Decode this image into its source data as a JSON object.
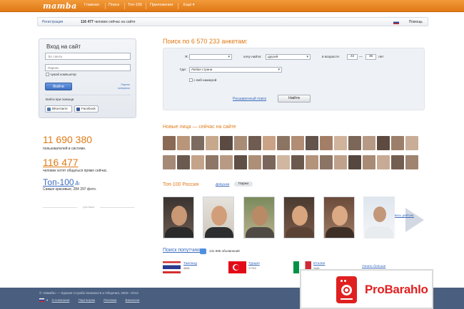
{
  "brand": {
    "logo": "mamba"
  },
  "topnav": [
    "Главная",
    "Поиск",
    "Топ-100",
    "Приложения",
    "Ещё ▾"
  ],
  "subbar": {
    "register": "Регистрация",
    "online_count": "116 477",
    "online_text": "человек сейчас на сайте",
    "help": "Помощь"
  },
  "login": {
    "title": "Вход на сайт",
    "email_placeholder": "Эл. почта",
    "password_placeholder": "Пароль",
    "remember": "чужой компьютер",
    "submit": "Войти",
    "forgot": "Пароль потерялся",
    "via": "Войти при помощи",
    "social": [
      "ВКонтакте",
      "Facebook"
    ]
  },
  "stats": {
    "users_count": "11 690 380",
    "users_text": "пользователей в системе.",
    "chat_count": "116 477",
    "chat_text": "человек хотят общаться прямо сейчас.",
    "top_title": "Топ-100",
    "top_text": "Самые красивые, 284 297 фото.",
    "ad_label": "реклама"
  },
  "search": {
    "title": "Поиск по 6 570 233 анкетам:",
    "i_label": "Я:",
    "i_value": "",
    "want_label": "хочу найти:",
    "want_value": "друзей",
    "age_label": "в возрасте:",
    "age_from": "22",
    "age_to": "35",
    "age_sep": "—",
    "age_unit": "лет",
    "where_label": "Где:",
    "where_value": "Любая страна",
    "webcam": "с веб-камерой",
    "advanced": "Расширенный поиск",
    "find": "Найти"
  },
  "new_faces": {
    "title": "Новые лица — сейчас на сайте"
  },
  "top100": {
    "title": "Топ-100 Россия",
    "tab_girls": "Девушки",
    "tab_guys": "Парни",
    "all_rating": "весь рейтинг"
  },
  "travel": {
    "title": "Поиск попутчиков",
    "count": "131 595 объявлений",
    "destinations": [
      {
        "name": "Таиланд",
        "count": "4696"
      },
      {
        "name": "Турция",
        "count": "17743"
      },
      {
        "name": "Италия",
        "count": "2446"
      }
    ],
    "more": "Узнать больше"
  },
  "footer": {
    "copy": "© «Мамба» — Единая Служба Знакомств и Общения, 2002—2012",
    "links": [
      "О компании",
      "Партнерам",
      "Реклама",
      "Вакансии"
    ]
  },
  "watermark": {
    "brand": "ProBarahlo"
  },
  "colors": {
    "accent": "#e07a16",
    "link": "#3b6cbf",
    "footer": "#4a5f7f"
  }
}
